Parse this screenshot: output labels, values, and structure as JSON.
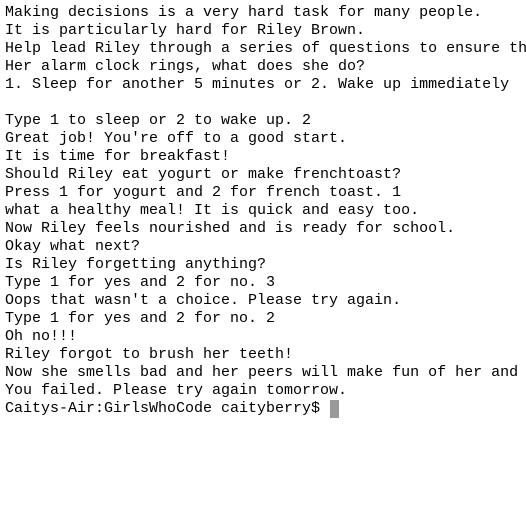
{
  "terminal": {
    "lines": [
      "Making decisions is a very hard task for many people.",
      "It is particularly hard for Riley Brown.",
      "Help lead Riley through a series of questions to ensure th",
      "Her alarm clock rings, what does she do?",
      "1. Sleep for another 5 minutes or 2. Wake up immediately",
      "",
      "Type 1 to sleep or 2 to wake up. 2",
      "Great job! You're off to a good start.",
      "It is time for breakfast!",
      "Should Riley eat yogurt or make frenchtoast?",
      "Press 1 for yogurt and 2 for french toast. 1",
      "what a healthy meal! It is quick and easy too.",
      "Now Riley feels nourished and is ready for school.",
      "Okay what next?",
      "Is Riley forgetting anything?",
      "Type 1 for yes and 2 for no. 3",
      "Oops that wasn't a choice. Please try again.",
      "Type 1 for yes and 2 for no. 2",
      "Oh no!!!",
      "Riley forgot to brush her teeth!",
      "Now she smells bad and her peers will make fun of her and",
      "You failed. Please try again tomorrow."
    ],
    "prompt": "Caitys-Air:GirlsWhoCode caityberry$ ",
    "cursor_color": "#999999"
  }
}
